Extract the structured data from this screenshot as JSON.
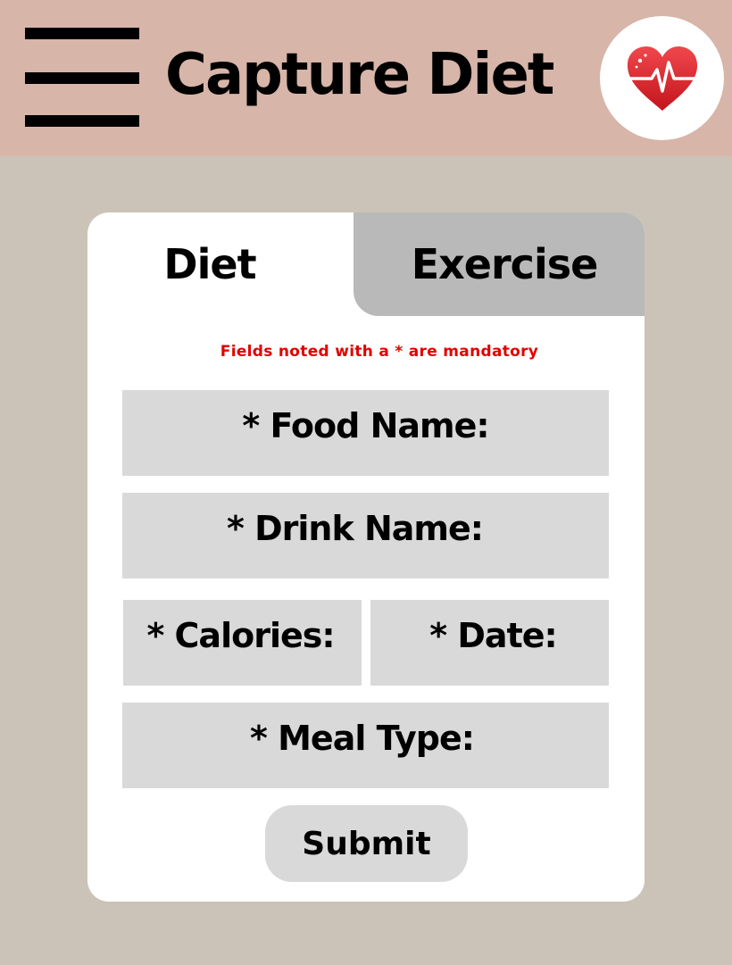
{
  "header": {
    "title": "Capture Diet",
    "menu_icon": "hamburger-menu-icon",
    "logo_icon": "heart-pulse-icon",
    "background": "#d8b5a9"
  },
  "tabs": [
    {
      "label": "Diet",
      "active": true
    },
    {
      "label": "Exercise",
      "active": false
    }
  ],
  "form": {
    "note": "Fields noted with a * are mandatory",
    "fields": {
      "food": "* Food Name:",
      "drink": "* Drink Name:",
      "calories": "* Calories:",
      "date": "* Date:",
      "meal": "* Meal Type:"
    },
    "submit_label": "Submit"
  },
  "colors": {
    "page_background": "#cbc3b7",
    "field_background": "#d9d9d9",
    "inactive_tab": "#b9b9b9",
    "mandatory_note": "#e10000",
    "heart": "#e3242b"
  }
}
